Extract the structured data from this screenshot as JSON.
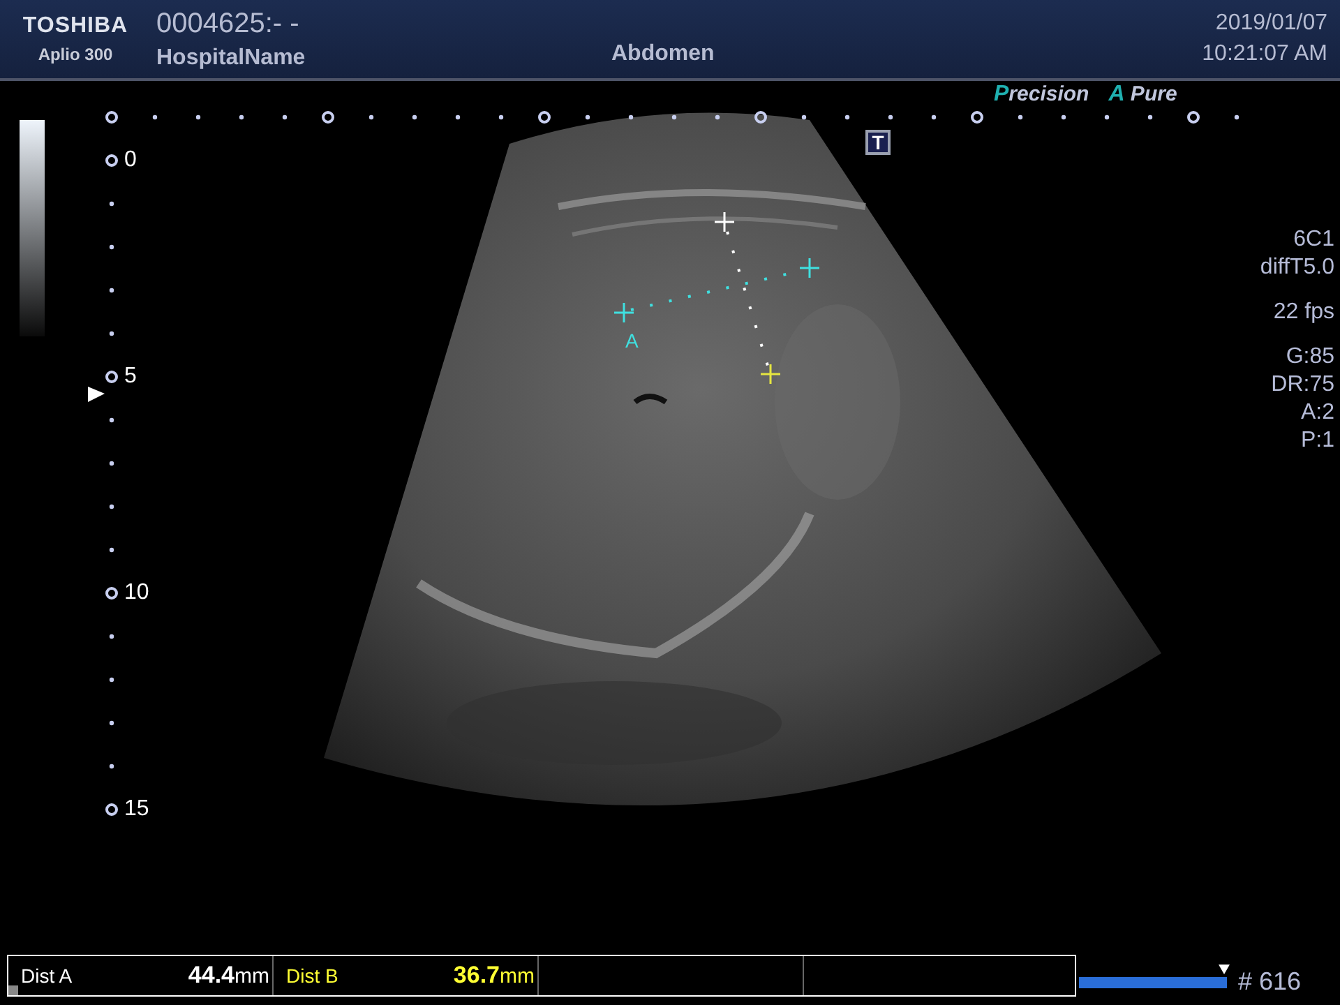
{
  "header": {
    "brand": "TOSHIBA",
    "model": "Aplio 300",
    "patient_id": "0004625:- -",
    "hospital": "HospitalName",
    "preset": "Abdomen",
    "date": "2019/01/07",
    "time": "10:21:07 AM"
  },
  "image_modes": [
    "Precision",
    "A Pure"
  ],
  "orientation_mark": "T",
  "depth_labels": [
    "0",
    "5",
    "10",
    "15"
  ],
  "parameter_groups": [
    [
      "6C1",
      "diffT5.0"
    ],
    [
      "22 fps"
    ],
    [
      "G:85",
      "DR:75",
      "A:2",
      "P:1"
    ]
  ],
  "caliper_label": "A",
  "measurements": [
    {
      "label": "Dist A",
      "value": "**44.4**mm",
      "color": "#ffffff"
    },
    {
      "label": "Dist B",
      "value": "**36.7**mm",
      "color": "#ffff33"
    }
  ],
  "cine": {
    "level": 1,
    "frame": "# 616"
  }
}
